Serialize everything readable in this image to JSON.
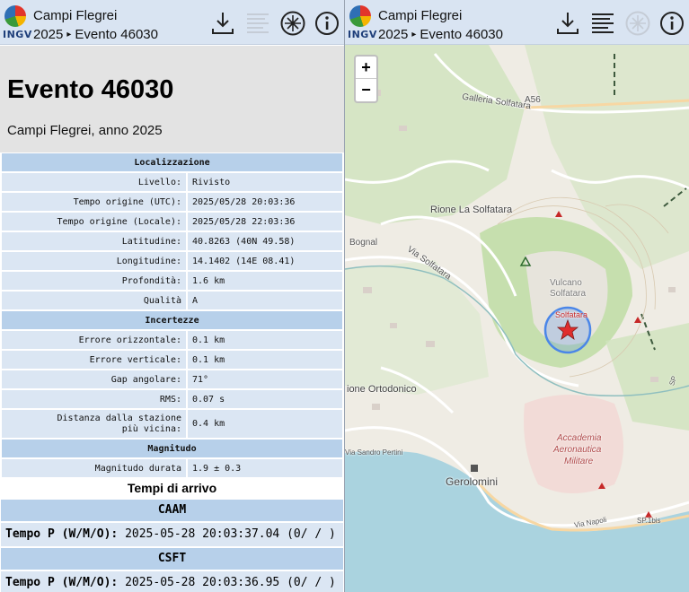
{
  "header": {
    "app_title": "Campi Flegrei",
    "year": "2025",
    "separator": "▸",
    "event": "Evento 46030",
    "logo_text": "INGV"
  },
  "toolbar_icons": [
    "download-icon",
    "list-icon",
    "no-map-icon",
    "info-icon"
  ],
  "event": {
    "title": "Evento 46030",
    "subtitle": "Campi Flegrei, anno 2025"
  },
  "info": {
    "localizzazione": {
      "heading": "Localizzazione",
      "rows": [
        {
          "k": "Livello:",
          "v": "Rivisto"
        },
        {
          "k": "Tempo origine (UTC):",
          "v": "2025/05/28 20:03:36"
        },
        {
          "k": "Tempo origine (Locale):",
          "v": "2025/05/28 22:03:36"
        },
        {
          "k": "Latitudine:",
          "v": "40.8263 (40N 49.58)"
        },
        {
          "k": "Longitudine:",
          "v": "14.1402 (14E 08.41)"
        },
        {
          "k": "Profondità:",
          "v": "1.6 km"
        },
        {
          "k": "Qualità",
          "v": "A"
        }
      ]
    },
    "incertezze": {
      "heading": "Incertezze",
      "rows": [
        {
          "k": "Errore orizzontale:",
          "v": "0.1 km"
        },
        {
          "k": "Errore verticale:",
          "v": "0.1 km"
        },
        {
          "k": "Gap angolare:",
          "v": "71°"
        },
        {
          "k": "RMS:",
          "v": "0.07 s"
        }
      ],
      "distance_k1": "Distanza dalla stazione",
      "distance_k2": "più vicina:",
      "distance_v": "0.4 km"
    },
    "magnitudo": {
      "heading": "Magnitudo",
      "k": "Magnitudo durata",
      "v": "1.9 ± 0.3"
    }
  },
  "arrivals": {
    "title": "Tempi di arrivo",
    "stations": [
      {
        "name": "CAAM",
        "label": "Tempo P (W/M/O):",
        "value": "2025-05-28 20:03:37.04 (0/ / )"
      },
      {
        "name": "CSFT",
        "label": "Tempo P (W/M/O):",
        "value": "2025-05-28 20:03:36.95 (0/ / )"
      }
    ]
  },
  "map": {
    "zoom_in": "+",
    "zoom_out": "−",
    "labels": {
      "galleria": "Galleria Solfatara",
      "a56": "A56",
      "rione": "Rione La Solfatara",
      "bagnoli": "Bognal",
      "via_solfatara": "Via Solfatara",
      "vulcano1": "Vulcano",
      "vulcano2": "Solfatara",
      "solfatara": "Solfatara",
      "ortodonico": "ione Ortodonico",
      "accademia1": "Accademia",
      "accademia2": "Aeronautica",
      "accademia3": "Militare",
      "via_sandro": "Via Sandro Pertini",
      "gerolomini": "Gerolomini",
      "via_napoli": "Via Napoli",
      "sp1bis": "SP.1bis",
      "sp": "SP"
    },
    "colors": {
      "sea": "#aad3df",
      "park": "#c8dfb4",
      "epicenter": "#e02d2d",
      "circle": "#4a86e8"
    }
  }
}
